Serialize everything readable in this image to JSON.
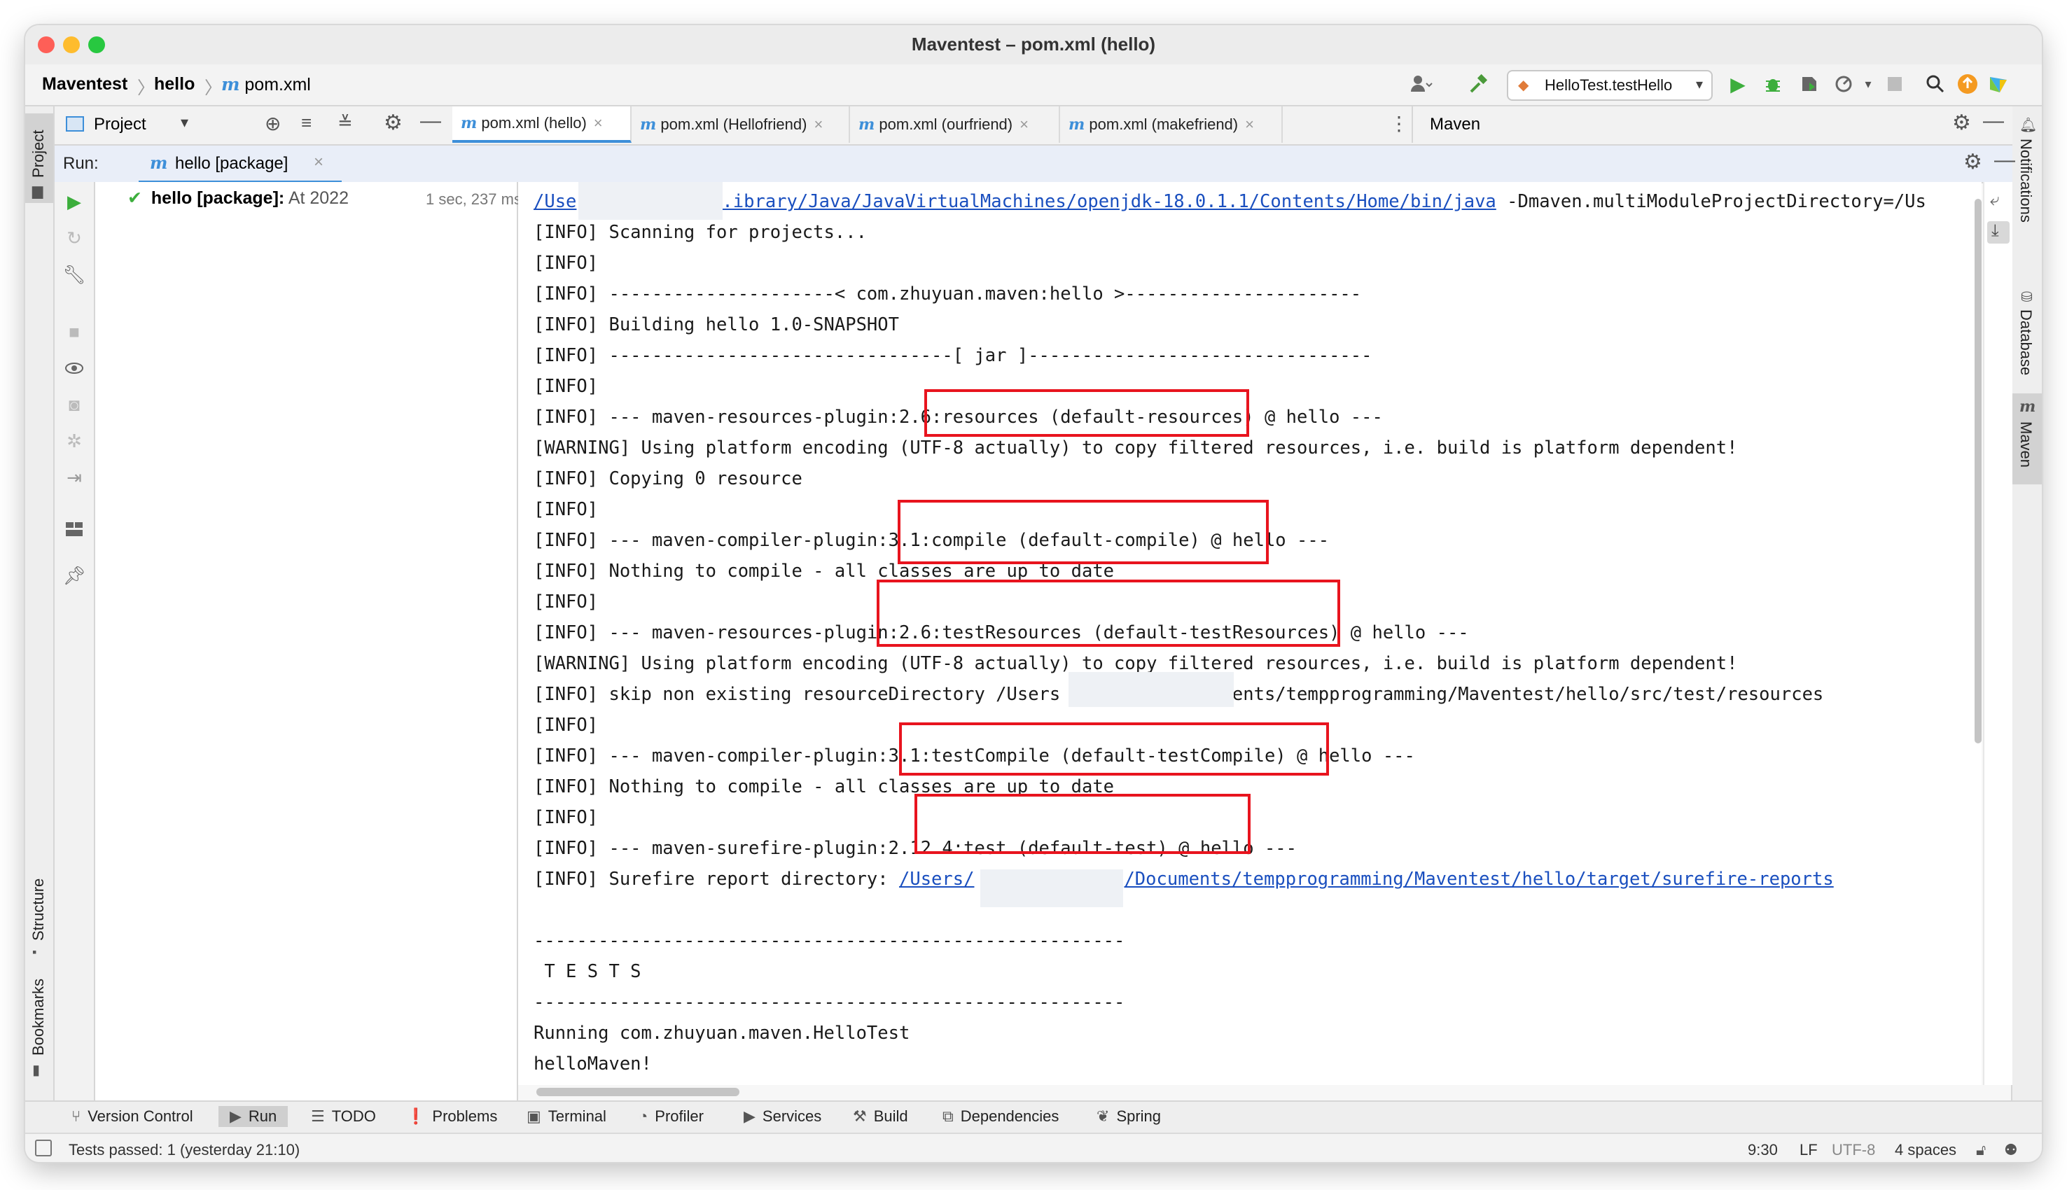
{
  "window": {
    "title": "Maventest – pom.xml (hello)"
  },
  "breadcrumb": {
    "project": "Maventest",
    "module": "hello",
    "file": "pom.xml",
    "file_icon": "m"
  },
  "toolbar": {
    "run_config": "HelloTest.testHello"
  },
  "left_stripe": {
    "project_label": "Project",
    "structure_label": "Structure",
    "bookmarks_label": "Bookmarks"
  },
  "right_stripe": {
    "notifications_label": "Notifications",
    "database_label": "Database",
    "maven_label": "Maven"
  },
  "project_panel": {
    "label": "Project"
  },
  "editor_tabs": [
    {
      "label": "pom.xml (hello)",
      "active": true
    },
    {
      "label": "pom.xml (Hellofriend)",
      "active": false
    },
    {
      "label": "pom.xml (ourfriend)",
      "active": false
    },
    {
      "label": "pom.xml (makefriend)",
      "active": false
    }
  ],
  "maven_panel": {
    "title": "Maven"
  },
  "run": {
    "label": "Run:",
    "tab_label": "hello [package]",
    "tree_item_name": "hello [package]:",
    "tree_item_detail": "At 2022",
    "tree_item_time": "1 sec, 237 ms"
  },
  "console": {
    "line0_link_a": "/Use",
    "line0_link_b": ".ibrary/Java/JavaVirtualMachines/openjdk-18.0.1.1/Contents/Home/bin/java",
    "line0_arg": " -Dmaven.multiModuleProjectDirectory=/Us",
    "lines": [
      "[INFO] Scanning for projects...",
      "[INFO]",
      "[INFO] ---------------------< com.zhuyuan.maven:hello >----------------------",
      "[INFO] Building hello 1.0-SNAPSHOT",
      "[INFO] --------------------------------[ jar ]--------------------------------",
      "[INFO]",
      "[INFO] --- maven-resources-plugin:2.6:resources (default-resources) @ hello ---",
      "[WARNING] Using platform encoding (UTF-8 actually) to copy filtered resources, i.e. build is platform dependent!",
      "[INFO] Copying 0 resource",
      "[INFO]",
      "[INFO] --- maven-compiler-plugin:3.1:compile (default-compile) @ hello ---",
      "[INFO] Nothing to compile - all classes are up to date",
      "[INFO]",
      "[INFO] --- maven-resources-plugin:2.6:testResources (default-testResources) @ hello ---",
      "[WARNING] Using platform encoding (UTF-8 actually) to copy filtered resources, i.e. build is platform dependent!",
      "[INFO] skip non existing resourceDirectory /Users            ocuments/tempprogramming/Maventest/hello/src/test/resources",
      "[INFO]",
      "[INFO] --- maven-compiler-plugin:3.1:testCompile (default-testCompile) @ hello ---",
      "[INFO] Nothing to compile - all classes are up to date",
      "[INFO]",
      "[INFO] --- maven-surefire-plugin:2.12.4:test (default-test) @ hello ---"
    ],
    "surefire_prefix": "[INFO] Surefire report directory: ",
    "surefire_link_a": "/Users/",
    "surefire_link_b": "/Documents/tempprogramming/Maventest/hello/target/surefire-reports",
    "tail": [
      "",
      "-------------------------------------------------------",
      " T E S T S",
      "-------------------------------------------------------",
      "Running com.zhuyuan.maven.HelloTest",
      "helloMaven!"
    ]
  },
  "bottom_tools": [
    {
      "label": "Version Control",
      "icon": "vcs-icon"
    },
    {
      "label": "Run",
      "icon": "run-icon",
      "active": true
    },
    {
      "label": "TODO",
      "icon": "todo-icon"
    },
    {
      "label": "Problems",
      "icon": "problems-icon"
    },
    {
      "label": "Terminal",
      "icon": "terminal-icon"
    },
    {
      "label": "Profiler",
      "icon": "profiler-icon"
    },
    {
      "label": "Services",
      "icon": "services-icon"
    },
    {
      "label": "Build",
      "icon": "build-icon"
    },
    {
      "label": "Dependencies",
      "icon": "dependencies-icon"
    },
    {
      "label": "Spring",
      "icon": "spring-icon"
    }
  ],
  "status": {
    "message": "Tests passed: 1 (yesterday 21:10)",
    "position": "9:30",
    "line_sep": "LF",
    "encoding": "UTF-8",
    "indent": "4 spaces"
  },
  "colors": {
    "accent": "#3d8fd9",
    "highlight": "#e8141e",
    "run_green": "#3cae3c"
  }
}
